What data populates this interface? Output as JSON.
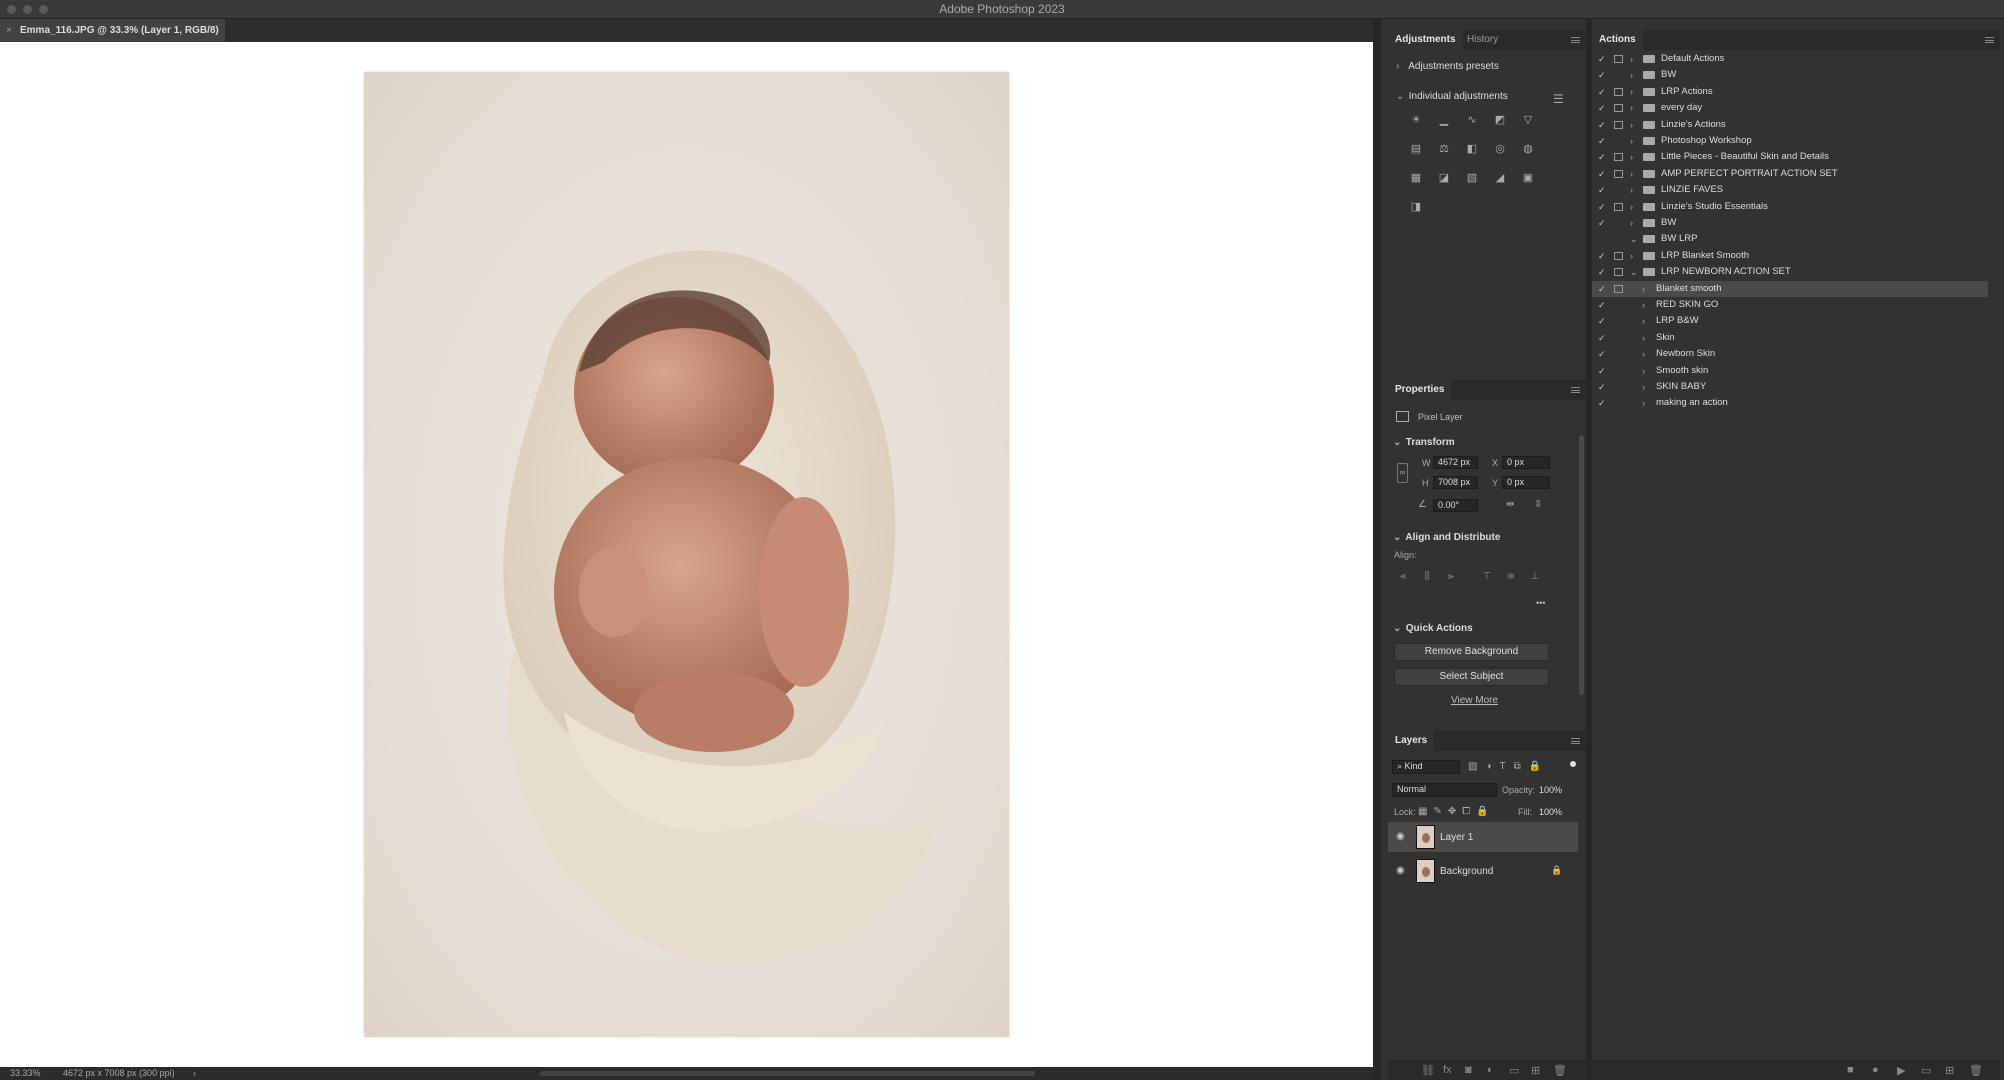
{
  "app": {
    "title": "Adobe Photoshop 2023"
  },
  "document": {
    "tab_title": "Emma_116.JPG @ 33.3% (Layer 1, RGB/8) *",
    "close_glyph": "×"
  },
  "status": {
    "zoom": "33.33%",
    "doc_info": "4672 px x 7008 px (300 ppi)",
    "arrow": "›"
  },
  "adjustments": {
    "tab_active": "Adjustments",
    "tab_inactive": "History",
    "presets_label": "Adjustments presets",
    "individual_label": "Individual adjustments"
  },
  "properties": {
    "tab": "Properties",
    "layer_type": "Pixel Layer",
    "transform_label": "Transform",
    "w_label": "W",
    "w_value": "4672 px",
    "h_label": "H",
    "h_value": "7008 px",
    "x_label": "X",
    "x_value": "0 px",
    "y_label": "Y",
    "y_value": "0 px",
    "angle_value": "0.00°",
    "align_label": "Align and Distribute",
    "align_sub": "Align:",
    "more": "•••",
    "quick_label": "Quick Actions",
    "remove_bg": "Remove Background",
    "select_subject": "Select Subject",
    "view_more": "View More"
  },
  "layers": {
    "tab": "Layers",
    "kind": "Kind",
    "blend_mode": "Normal",
    "opacity_label": "Opacity:",
    "opacity_value": "100%",
    "lock_label": "Lock:",
    "fill_label": "Fill:",
    "fill_value": "100%",
    "items": [
      {
        "name": "Layer 1"
      },
      {
        "name": "Background"
      }
    ]
  },
  "actions": {
    "tab": "Actions",
    "items": [
      {
        "label": "Default Actions"
      },
      {
        "label": "BW"
      },
      {
        "label": "LRP Actions"
      },
      {
        "label": "every day"
      },
      {
        "label": "Linzie's Actions"
      },
      {
        "label": "Photoshop Workshop"
      },
      {
        "label": "Little Pieces - Beautiful Skin and Details"
      },
      {
        "label": "AMP PERFECT PORTRAIT ACTION SET"
      },
      {
        "label": "LINZIE FAVES"
      },
      {
        "label": "Linzie's Studio Essentials"
      },
      {
        "label": "BW"
      },
      {
        "label": "BW LRP"
      },
      {
        "label": "LRP Blanket Smooth"
      },
      {
        "label": "LRP NEWBORN ACTION SET"
      },
      {
        "label": "Blanket smooth"
      },
      {
        "label": "RED SKIN GO"
      },
      {
        "label": "LRP B&W"
      },
      {
        "label": "Skin"
      },
      {
        "label": "Newborn Skin"
      },
      {
        "label": "Smooth skin"
      },
      {
        "label": "SKIN BABY"
      },
      {
        "label": "making an action"
      }
    ]
  },
  "glyphs": {
    "check": "✓",
    "chev_right": "›",
    "chev_down": "⌄",
    "eye": "◉",
    "lock": "🔒"
  },
  "colors": {
    "canvas_bg": "#ffffff",
    "panel_bg": "#323232",
    "selection": "#4a4a4a"
  }
}
